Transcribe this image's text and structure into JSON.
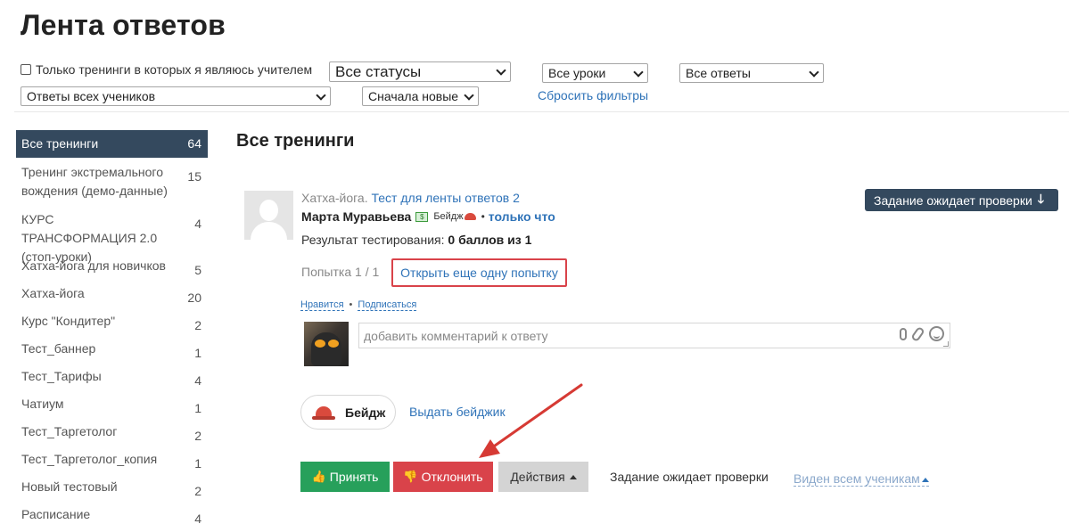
{
  "page": {
    "title": "Лента ответов"
  },
  "filters": {
    "teacher_only_label": "Только тренинги в которых я являюсь учителем",
    "status_select": "Все статусы",
    "lessons_select": "Все уроки",
    "answers_select": "Все ответы",
    "students_select": "Ответы всех учеников",
    "sort_select": "Сначала новые",
    "reset_label": "Сбросить фильтры"
  },
  "sidebar": {
    "items": [
      {
        "label": "Все тренинги",
        "count": "64",
        "active": true
      },
      {
        "label": "Тренинг экстремального вождения (демо-данные)",
        "count": "15"
      },
      {
        "label": "КУРС ТРАНСФОРМАЦИЯ 2.0 (стоп-уроки)",
        "count": "4"
      },
      {
        "label": "Хатха-йога для новичков",
        "count": "5"
      },
      {
        "label": "Хатха-йога",
        "count": "20"
      },
      {
        "label": "Курс \"Кондитер\"",
        "count": "2"
      },
      {
        "label": "Тест_баннер",
        "count": "1"
      },
      {
        "label": "Тест_Тарифы",
        "count": "4"
      },
      {
        "label": "Чатиум",
        "count": "1"
      },
      {
        "label": "Тест_Таргетолог",
        "count": "2"
      },
      {
        "label": "Тест_Таргетолог_копия",
        "count": "1"
      },
      {
        "label": "Новый тестовый",
        "count": "2"
      },
      {
        "label": "Расписание",
        "count": "4"
      }
    ]
  },
  "main": {
    "section_title": "Все тренинги",
    "answer": {
      "training": "Хатха-йога.",
      "lesson": "Тест для ленты ответов 2",
      "user_name": "Марта Муравьева",
      "badge_mini": "Бейдж",
      "time": "только что",
      "result_label": "Результат тестирования:",
      "result_value": "0 баллов из 1",
      "attempt": "Попытка 1 / 1",
      "open_attempt": "Открыть еще одну попытку",
      "status_button": "Задание ожидает проверки",
      "like": "Нравится",
      "subscribe": "Подписаться",
      "comment_placeholder": "добавить комментарий к ответу",
      "badge_label": "Бейдж",
      "give_badge": "Выдать бейджик",
      "accept": "Принять",
      "reject": "Отклонить",
      "actions": "Действия",
      "status_text": "Задание ожидает проверки",
      "visibility": "Виден всем ученикам"
    }
  },
  "colors": {
    "accent_blue": "#2f73b8",
    "sidebar_active": "#34495e",
    "accept_green": "#27a05b",
    "reject_red": "#d9434a",
    "annotation_red": "#d63a34"
  },
  "icons": [
    "checkbox-icon",
    "chevron-down-icon",
    "money-icon",
    "hat-icon",
    "arrow-down-icon",
    "mic-icon",
    "paperclip-icon",
    "smile-icon",
    "thumbs-up-icon",
    "thumbs-down-icon",
    "caret-up-icon"
  ]
}
